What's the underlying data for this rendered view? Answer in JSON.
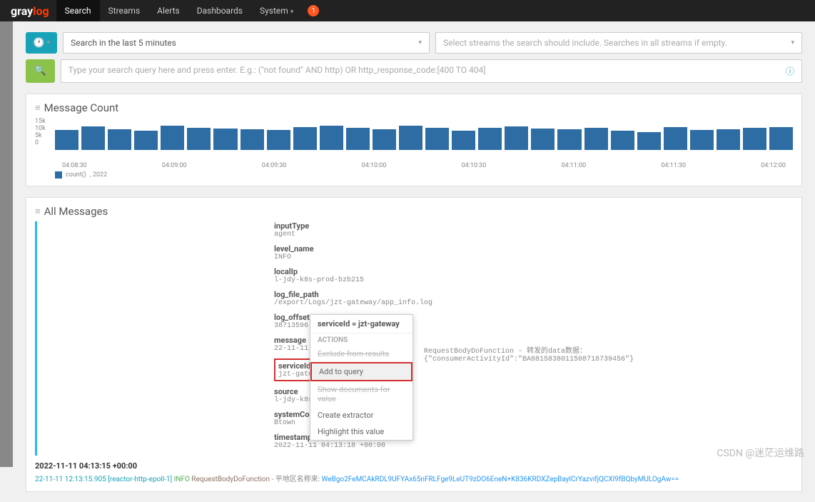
{
  "nav": {
    "logo_gray": "gray",
    "logo_log": "log",
    "items": [
      "Search",
      "Streams",
      "Alerts",
      "Dashboards",
      "System"
    ],
    "badge": "1"
  },
  "search": {
    "timerange": "Search in the last 5 minutes",
    "streams_placeholder": "Select streams the search should include. Searches in all streams if empty.",
    "query_placeholder": "Type your search query here and press enter. E.g.: (\"not found\" AND http) OR http_response_code:[400 TO 404]"
  },
  "chart_data": {
    "type": "bar",
    "title": "Message Count",
    "ylabel": "",
    "ylim": [
      0,
      15000
    ],
    "yticks": [
      "15k",
      "10k",
      "5k",
      "0"
    ],
    "categories": [
      "04:08:30",
      "04:09:00",
      "04:09:30",
      "04:10:00",
      "04:10:30",
      "04:11:00",
      "04:11:30",
      "04:12:00"
    ],
    "values": [
      9500,
      11000,
      9800,
      9000,
      11200,
      10500,
      10000,
      9800,
      9200,
      10800,
      11300,
      10200,
      9800,
      11500,
      10200,
      9000,
      10500,
      11000,
      10000,
      9800,
      10200,
      9000,
      8500,
      10800,
      9500,
      9800,
      10500,
      10800
    ],
    "legend": "count()",
    "legend_year": ", 2022"
  },
  "messages": {
    "title": "All Messages",
    "fields": [
      {
        "label": "inputType",
        "value": "agent"
      },
      {
        "label": "level_name",
        "value": "INFO"
      },
      {
        "label": "localIp",
        "value": "l-jdy-k8s-prod-bzb215"
      },
      {
        "label": "log_file_path",
        "value": "/export/Logs/jzt-gateway/app_info.log"
      },
      {
        "label": "log_offset",
        "value": "38713596"
      },
      {
        "label": "message",
        "value": "22-11-11. 12:1"
      },
      {
        "label": "serviceId",
        "value": "jzt-gateway",
        "boxed": true
      },
      {
        "label": "source",
        "value": "l-jdy-k8s-pro"
      },
      {
        "label": "systemCode",
        "value": "Btown"
      },
      {
        "label": "timestamp",
        "value": "2022-11-11 04:13:18 +00:00"
      }
    ],
    "msg_tail": "RequestBodyDoFunction  - 转发的data数据：{\"consumerActivityId\":\"BA8815838011508718739456\"}",
    "context": {
      "header": "serviceId = jzt-gateway",
      "section": "ACTIONS",
      "items": [
        {
          "label": "Exclude from results",
          "strike": true
        },
        {
          "label": "Add to query",
          "hl": true,
          "boxed": true
        },
        {
          "label": "Show documents for value",
          "strike": true
        },
        {
          "label": "Create extractor"
        },
        {
          "label": "Highlight this value"
        }
      ]
    },
    "timestamp_row": "2022-11-11 04:13:15 +00:00",
    "log_line_prefix": "22-11-11 12:13:15.905 [reactor-http-epoll-1]",
    "log_line_level": " INFO ",
    "log_line_func": "RequestBodyDoFunction",
    "log_line_mid": " - 平地区名称来: ",
    "log_line_hash": "WeBgo2FeMCAkRDL9UFYAx65nFRLFge9LeUT9zDO6EneN+K836KRDXZepBaylCrYazvifjQCXl9fBQbyMULOgAw=="
  },
  "watermark": "CSDN @迷茫运维路"
}
